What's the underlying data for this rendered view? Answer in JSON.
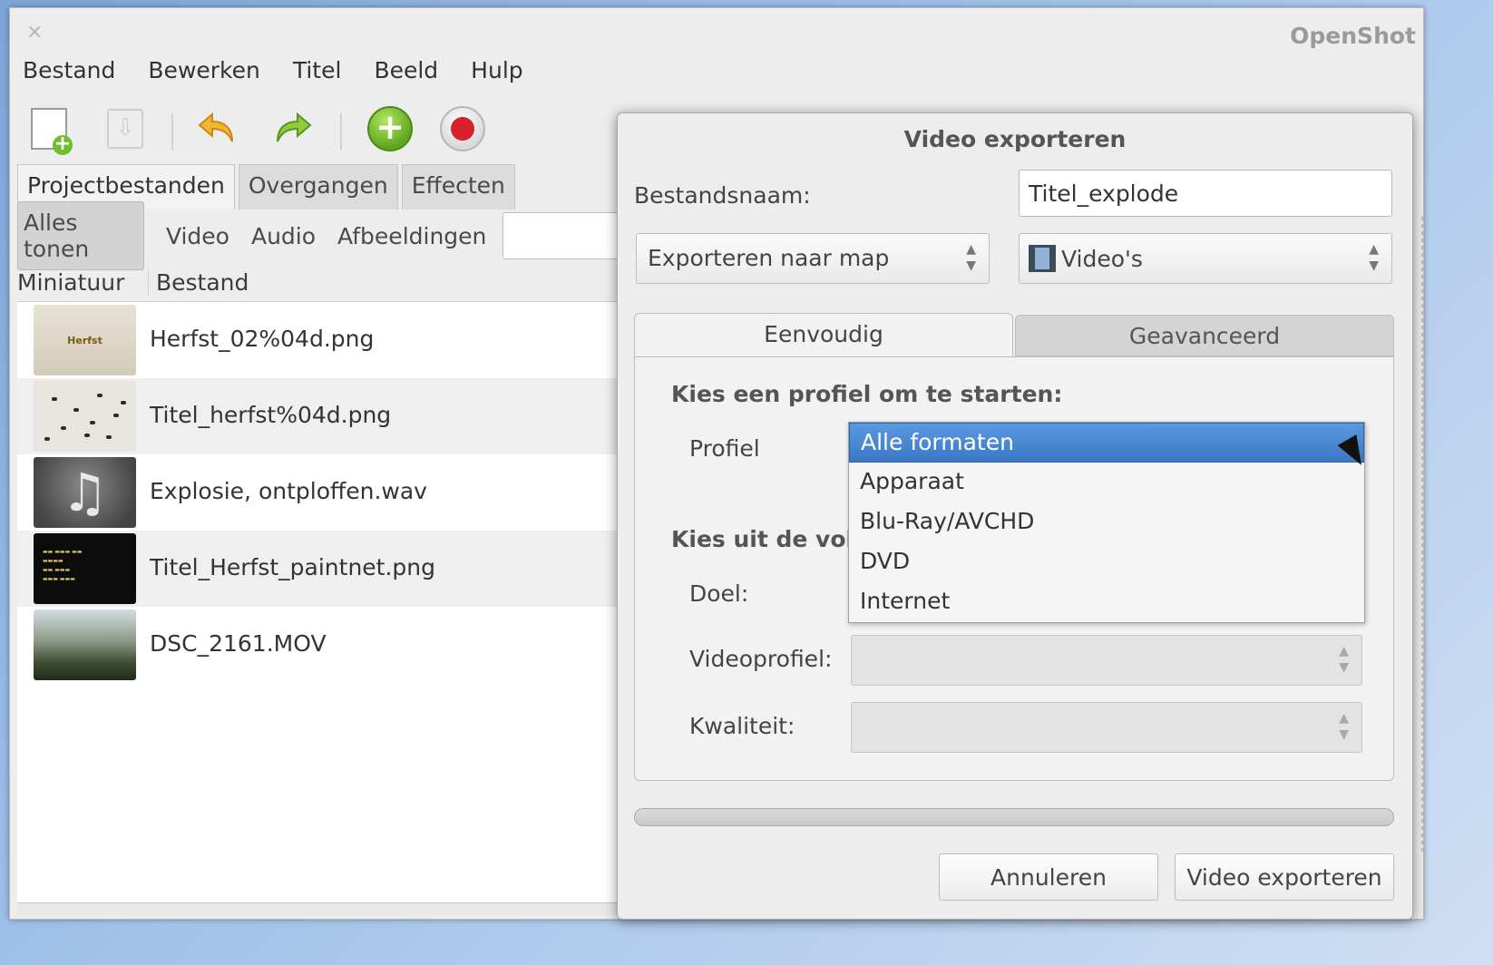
{
  "window": {
    "close_glyph": "×",
    "app_title": "OpenShot"
  },
  "menu": [
    "Bestand",
    "Bewerken",
    "Titel",
    "Beeld",
    "Hulp"
  ],
  "toolbar": {
    "icons": [
      "new-project-icon",
      "import-icon",
      "undo-icon",
      "redo-icon",
      "add-icon",
      "record-icon"
    ]
  },
  "left_tabs": [
    "Projectbestanden",
    "Overgangen",
    "Effecten"
  ],
  "filters": [
    "Alles tonen",
    "Video",
    "Audio",
    "Afbeeldingen"
  ],
  "file_table": {
    "headers": [
      "Miniatuur",
      "Bestand"
    ],
    "rows": [
      {
        "name": "Herfst_02%04d.png",
        "thumb_text": "Herfst"
      },
      {
        "name": "Titel_herfst%04d.png"
      },
      {
        "name": "Explosie, ontploffen.wav"
      },
      {
        "name": "Titel_Herfst_paintnet.png"
      },
      {
        "name": "DSC_2161.MOV"
      }
    ]
  },
  "dialog": {
    "title": "Video exporteren",
    "filename_label": "Bestandsnaam:",
    "filename_value": "Titel_explode",
    "export_mode": "Exporteren naar map",
    "folder": "Video's",
    "tabs": [
      "Eenvoudig",
      "Geavanceerd"
    ],
    "section1": "Kies een profiel om te starten:",
    "section2_visible": "Kies uit de volg",
    "profile_label": "Profiel",
    "target_label": "Doel:",
    "videoprofile_label": "Videoprofiel:",
    "quality_label": "Kwaliteit:",
    "dropdown_options": [
      "Alle formaten",
      "Apparaat",
      "Blu-Ray/AVCHD",
      "DVD",
      "Internet"
    ],
    "selected_option": "Alle formaten",
    "progress": 0,
    "cancel_button": "Annuleren",
    "export_button": "Video exporteren"
  },
  "colors": {
    "selection": "#3b78c4",
    "record": "#d7202b",
    "add": "#5ea71c"
  }
}
